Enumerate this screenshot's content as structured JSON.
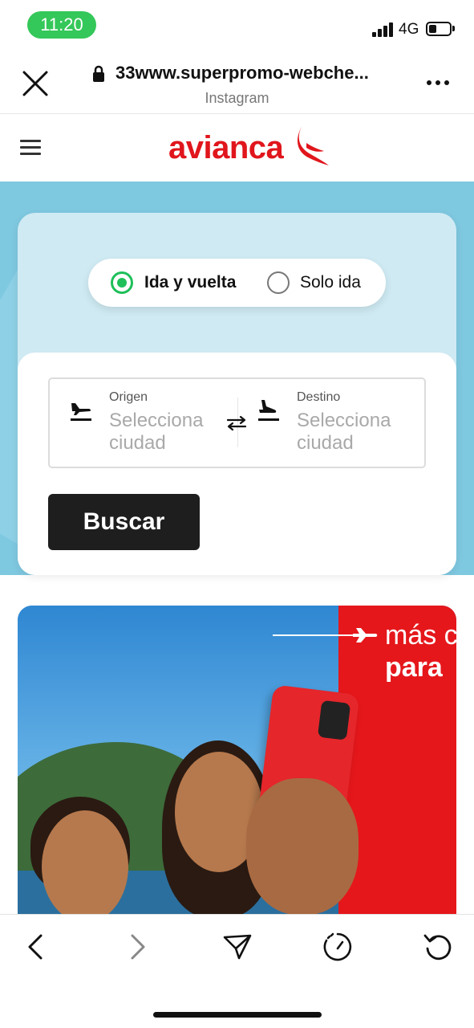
{
  "status_bar": {
    "time": "11:20",
    "network": "4G"
  },
  "browser": {
    "url": "33www.superpromo-webche...",
    "source": "Instagram"
  },
  "site": {
    "brand": "avianca",
    "brand_color": "#e0161c"
  },
  "booking": {
    "trip_options": [
      {
        "label": "Ida y vuelta",
        "selected": true
      },
      {
        "label": "Solo ida",
        "selected": false
      }
    ],
    "origin": {
      "label": "Origen",
      "placeholder": "Selecciona ciudad"
    },
    "destination": {
      "label": "Destino",
      "placeholder": "Selecciona ciudad"
    },
    "search_label": "Buscar",
    "accent_color": "#1fbf5a"
  },
  "promo": {
    "line1": "más c",
    "line2": "para"
  },
  "toolbar": {
    "icons": [
      "back-icon",
      "forward-icon",
      "share-icon",
      "speed-icon",
      "reload-icon"
    ]
  }
}
